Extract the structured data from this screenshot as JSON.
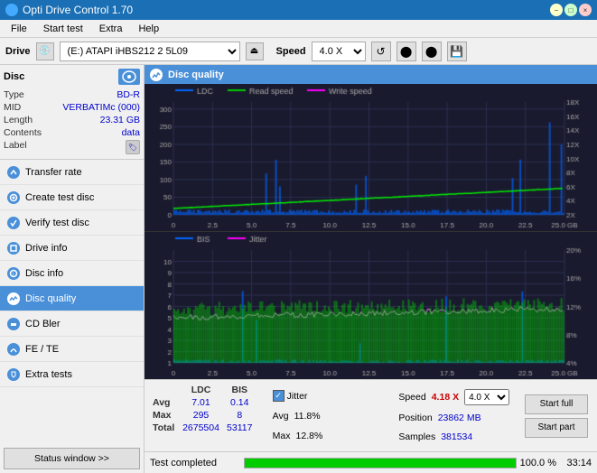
{
  "titleBar": {
    "title": "Opti Drive Control 1.70",
    "controls": [
      "minimize",
      "maximize",
      "close"
    ]
  },
  "menuBar": {
    "items": [
      "File",
      "Start test",
      "Extra",
      "Help"
    ]
  },
  "driveBar": {
    "driveLabel": "Drive",
    "driveValue": "(E:)  ATAPI iHBS212  2 5L09",
    "speedLabel": "Speed",
    "speedValue": "4.0 X"
  },
  "discSection": {
    "title": "Disc",
    "fields": [
      {
        "key": "Type",
        "value": "BD-R"
      },
      {
        "key": "MID",
        "value": "VERBATIMc (000)"
      },
      {
        "key": "Length",
        "value": "23.31 GB"
      },
      {
        "key": "Contents",
        "value": "data"
      },
      {
        "key": "Label",
        "value": ""
      }
    ]
  },
  "navItems": [
    {
      "label": "Transfer rate",
      "active": false
    },
    {
      "label": "Create test disc",
      "active": false
    },
    {
      "label": "Verify test disc",
      "active": false
    },
    {
      "label": "Drive info",
      "active": false
    },
    {
      "label": "Disc info",
      "active": false
    },
    {
      "label": "Disc quality",
      "active": true
    },
    {
      "label": "CD Bler",
      "active": false
    },
    {
      "label": "FE / TE",
      "active": false
    },
    {
      "label": "Extra tests",
      "active": false
    }
  ],
  "statusWindowBtn": "Status window >>",
  "contentHeader": "Disc quality",
  "legend": {
    "ldc": "LDC",
    "readSpeed": "Read speed",
    "writeSpeed": "Write speed",
    "bis": "BIS",
    "jitter": "Jitter"
  },
  "statsTable": {
    "headers": [
      "",
      "LDC",
      "BIS",
      "",
      "Jitter",
      "Speed"
    ],
    "rows": [
      {
        "label": "Avg",
        "ldc": "7.01",
        "bis": "0.14",
        "jitter": "11.8%",
        "speed": "4.18 X"
      },
      {
        "label": "Max",
        "ldc": "295",
        "bis": "8",
        "jitter": "12.8%"
      },
      {
        "label": "Total",
        "ldc": "2675504",
        "bis": "53117"
      }
    ],
    "position": "23862 MB",
    "samples": "381534",
    "speedDisplay": "4.0 X"
  },
  "buttons": {
    "startFull": "Start full",
    "startPart": "Start part"
  },
  "statusBar": {
    "text": "Test completed",
    "progress": 100,
    "progressText": "100.0 %",
    "time": "33:14"
  },
  "charts": {
    "upper": {
      "yAxisLeft": [
        300,
        250,
        200,
        150,
        100,
        50,
        0
      ],
      "yAxisRight": [
        "18X",
        "16X",
        "14X",
        "12X",
        "10X",
        "8X",
        "6X",
        "4X",
        "2X"
      ],
      "xAxis": [
        0,
        2.5,
        5.0,
        7.5,
        10.0,
        12.5,
        15.0,
        17.5,
        20.0,
        22.5,
        "25.0 GB"
      ]
    },
    "lower": {
      "yAxisLeft": [
        10,
        9,
        8,
        7,
        6,
        5,
        4,
        3,
        2,
        1
      ],
      "yAxisRight": [
        "20%",
        "16%",
        "12%",
        "8%",
        "4%"
      ],
      "xAxis": [
        0,
        2.5,
        5.0,
        7.5,
        10.0,
        12.5,
        15.0,
        17.5,
        20.0,
        22.5,
        "25.0 GB"
      ]
    }
  }
}
